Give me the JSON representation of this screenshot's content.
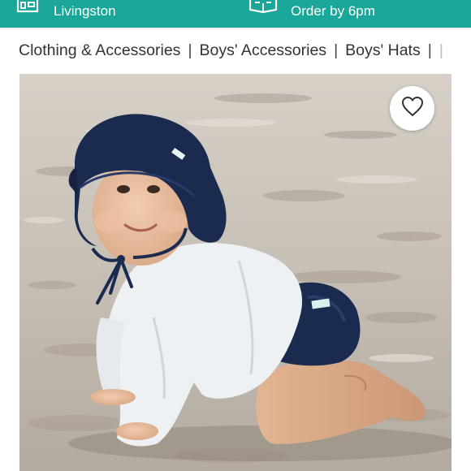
{
  "header": {
    "store_icon": "storefront-icon",
    "store_text": "Livingston",
    "shipping_icon": "package-icon",
    "shipping_text": "Order by 6pm",
    "colors": {
      "banner": "#1aa79a",
      "text": "#ffffff"
    }
  },
  "breadcrumb": {
    "items": [
      {
        "label": "Clothing & Accessories"
      },
      {
        "label": "Boys' Accessories"
      },
      {
        "label": "Boys' Hats"
      }
    ],
    "separator": "|"
  },
  "listing": {
    "photo_subject": "baby in navy sun hat crawling on sand",
    "like_icon": "heart-outline-icon"
  }
}
